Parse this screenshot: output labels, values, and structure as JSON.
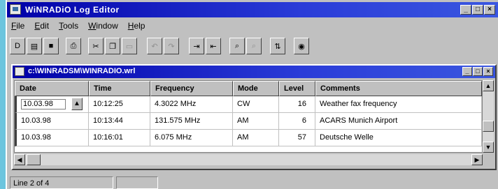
{
  "window": {
    "title": "WiNRADiO Log Editor"
  },
  "menu": [
    "File",
    "Edit",
    "Tools",
    "Window",
    "Help"
  ],
  "toolbar": [
    {
      "name": "new-icon",
      "glyph": "D"
    },
    {
      "name": "open-icon",
      "glyph": "▤"
    },
    {
      "name": "save-icon",
      "glyph": "■"
    },
    {
      "name": "print-icon",
      "glyph": "⎙"
    },
    {
      "name": "cut-icon",
      "glyph": "✂"
    },
    {
      "name": "copy-icon",
      "glyph": "❐"
    },
    {
      "name": "paste-icon",
      "glyph": "▭"
    },
    {
      "name": "undo-icon",
      "glyph": "↶"
    },
    {
      "name": "redo-icon",
      "glyph": "↷"
    },
    {
      "name": "insert-row-icon",
      "glyph": "⇥"
    },
    {
      "name": "delete-row-icon",
      "glyph": "⇤"
    },
    {
      "name": "find-icon",
      "glyph": "⌕"
    },
    {
      "name": "find-next-icon",
      "glyph": "⌕"
    },
    {
      "name": "sort-icon",
      "glyph": "⇅"
    },
    {
      "name": "tune-icon",
      "glyph": "◉"
    }
  ],
  "child": {
    "title": "c:\\WINRADSM\\WINRADIO.wrl",
    "columns": [
      "Date",
      "Time",
      "Frequency",
      "Mode",
      "Level",
      "Comments"
    ],
    "rows": [
      [
        "10.03.98",
        "10:12:25",
        "4.3022 MHz",
        "CW",
        "16",
        "Weather fax frequency"
      ],
      [
        "10.03.98",
        "10:13:44",
        "131.575 MHz",
        "AM",
        "6",
        "ACARS Munich Airport"
      ],
      [
        "10.03.98",
        "10:16:01",
        "6.075 MHz",
        "AM",
        "57",
        "Deutsche Welle"
      ]
    ]
  },
  "status": {
    "text": "Line 2 of 4"
  }
}
